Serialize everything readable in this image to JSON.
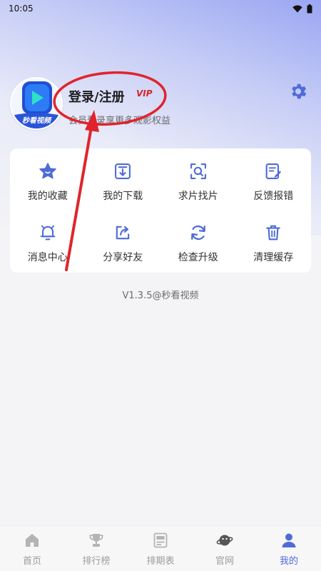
{
  "status_bar": {
    "time": "10:05"
  },
  "profile": {
    "avatar_caption": "秒看视频",
    "title": "登录/注册",
    "vip_badge": "VIP",
    "subtitle": "会员登录享更多观影权益"
  },
  "menu": {
    "items": [
      {
        "label": "我的收藏",
        "icon": "star-icon"
      },
      {
        "label": "我的下载",
        "icon": "download-icon"
      },
      {
        "label": "求片找片",
        "icon": "search-film-icon"
      },
      {
        "label": "反馈报错",
        "icon": "feedback-icon"
      },
      {
        "label": "消息中心",
        "icon": "bell-icon"
      },
      {
        "label": "分享好友",
        "icon": "share-icon"
      },
      {
        "label": "检查升级",
        "icon": "refresh-icon"
      },
      {
        "label": "清理缓存",
        "icon": "trash-icon"
      }
    ]
  },
  "version": "V1.3.5@秒看视频",
  "tabs": [
    {
      "label": "首页",
      "icon": "home-icon",
      "active": false
    },
    {
      "label": "排行榜",
      "icon": "trophy-icon",
      "active": false
    },
    {
      "label": "排期表",
      "icon": "schedule-icon",
      "active": false
    },
    {
      "label": "官网",
      "icon": "planet-icon",
      "active": false
    },
    {
      "label": "我的",
      "icon": "person-icon",
      "active": true
    }
  ],
  "colors": {
    "accent": "#4f6bd8",
    "annotation_red": "#e0242b",
    "vip_red": "#d8262b"
  }
}
